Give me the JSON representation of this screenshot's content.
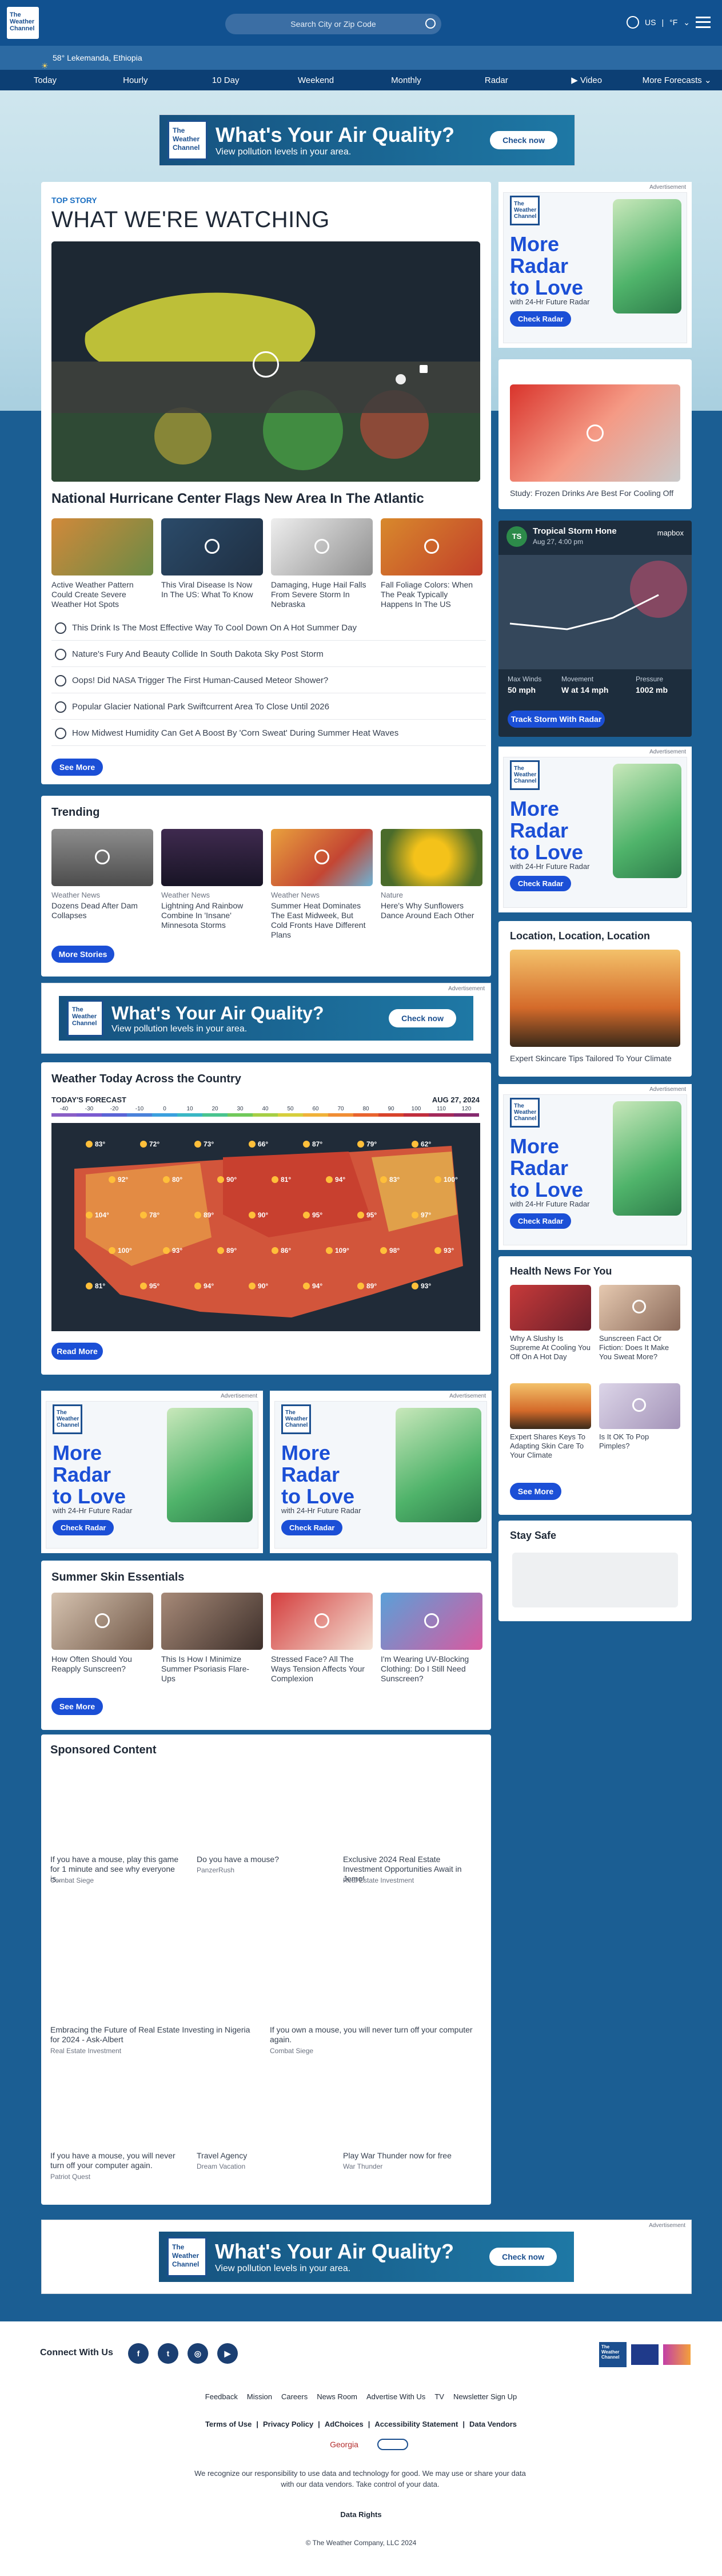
{
  "header": {
    "logo_text": "The Weather Channel",
    "search_placeholder": "Search City or Zip Code",
    "region": "US",
    "temp_unit": "°F"
  },
  "location": {
    "temp": "58°",
    "place": "Lekemanda, Ethiopia"
  },
  "nav": [
    "Today",
    "Hourly",
    "10 Day",
    "Weekend",
    "Monthly",
    "Radar",
    "Video",
    "More Forecasts"
  ],
  "air_ad": {
    "brand": "The Weather Channel",
    "headline": "What's Your Air Quality?",
    "sub": "View pollution levels in your area.",
    "cta": "Check now",
    "label": "Advertisement"
  },
  "radar_ad": {
    "brand": "The Weather Channel",
    "headline1": "More",
    "headline2": "Radar",
    "headline3": "to Love",
    "sub": "with 24-Hr Future Radar",
    "cta": "Check Radar",
    "label": "Advertisement"
  },
  "top_story": {
    "label": "TOP STORY",
    "title": "WHAT WE'RE WATCHING",
    "hero_caption": "National Hurricane Center Flags New Area In The Atlantic",
    "thumbs": [
      {
        "caption": "Active Weather Pattern Could Create Severe Weather Hot Spots"
      },
      {
        "caption": "This Viral Disease Is Now In The US: What To Know"
      },
      {
        "caption": "Damaging, Huge Hail Falls From Severe Storm In Nebraska"
      },
      {
        "caption": "Fall Foliage Colors: When The Peak Typically Happens In The US"
      }
    ],
    "list": [
      "This Drink Is The Most Effective Way To Cool Down On A Hot Summer Day",
      "Nature's Fury And Beauty Collide In South Dakota Sky Post Storm",
      "Oops! Did NASA Trigger The First Human-Caused Meteor Shower?",
      "Popular Glacier National Park Swiftcurrent Area To Close Until 2026",
      "How Midwest Humidity Can Get A Boost By 'Corn Sweat' During Summer Heat Waves"
    ],
    "more": "See More"
  },
  "trending": {
    "title": "Trending",
    "items": [
      {
        "tag": "Weather News",
        "caption": "Dozens Dead After Dam Collapses"
      },
      {
        "tag": "Weather News",
        "caption": "Lightning And Rainbow Combine In 'Insane' Minnesota Storms"
      },
      {
        "tag": "Weather News",
        "caption": "Summer Heat Dominates The East Midweek, But Cold Fronts Have Different Plans"
      },
      {
        "tag": "Nature",
        "caption": "Here's Why Sunflowers Dance Around Each Other"
      }
    ],
    "more": "More Stories"
  },
  "today_map": {
    "title": "Weather Today Across the Country",
    "forecast_label": "TODAY'S FORECAST",
    "date": "AUG 27, 2024",
    "scale": [
      "-40",
      "-30",
      "-20",
      "-10",
      "0",
      "10",
      "20",
      "30",
      "40",
      "50",
      "60",
      "70",
      "80",
      "90",
      "100",
      "110",
      "120"
    ],
    "temps": [
      "83°",
      "72°",
      "73°",
      "66°",
      "87°",
      "79°",
      "62°",
      "92°",
      "80°",
      "90°",
      "81°",
      "94°",
      "83°",
      "100°",
      "104°",
      "78°",
      "89°",
      "90°",
      "95°",
      "95°",
      "97°",
      "100°",
      "93°",
      "89°",
      "86°",
      "109°",
      "98°",
      "93°",
      "81°",
      "95°",
      "94°",
      "90°",
      "94°",
      "89°",
      "93°"
    ],
    "more": "Read More"
  },
  "skin": {
    "title": "Summer Skin Essentials",
    "items": [
      {
        "caption": "How Often Should You Reapply Sunscreen?"
      },
      {
        "caption": "This Is How I Minimize Summer Psoriasis Flare-Ups"
      },
      {
        "caption": "Stressed Face? All The Ways Tension Affects Your Complexion"
      },
      {
        "caption": "I'm Wearing UV-Blocking Clothing: Do I Still Need Sunscreen?"
      }
    ],
    "more": "See More"
  },
  "sponsored": {
    "title": "Sponsored Content",
    "items": [
      {
        "caption": "If you have a mouse, play this game for 1 minute and see why everyone is...",
        "source": "Combat Siege"
      },
      {
        "caption": "Do you have a mouse?",
        "source": "PanzerRush"
      },
      {
        "caption": "Exclusive 2024 Real Estate Investment Opportunities Await in Jemo!",
        "source": "Real Estate Investment"
      },
      {
        "caption": "Embracing the Future of Real Estate Investing in Nigeria for 2024 - Ask-Albert",
        "source": "Real Estate Investment"
      },
      {
        "caption": "If you own a mouse, you will never turn off your computer again.",
        "source": "Combat Siege"
      },
      {
        "caption": "If you have a mouse, you will never turn off your computer again.",
        "source": "Patriot Quest"
      },
      {
        "caption": "Travel Agency",
        "source": "Dream Vacation"
      },
      {
        "caption": "Play War Thunder now for free",
        "source": "War Thunder"
      }
    ]
  },
  "side": {
    "frozen_caption": "Study: Frozen Drinks Are Best For Cooling Off",
    "storm": {
      "name": "Tropical Storm Hone",
      "time": "Aug 27, 4:00 pm",
      "map_brand": "mapbox",
      "winds_label": "Max Winds",
      "winds": "50 mph",
      "move_label": "Movement",
      "move": "W at 14 mph",
      "pres_label": "Pressure",
      "pres": "1002 mb",
      "cta": "Track Storm With Radar",
      "badge": "TS"
    },
    "location": {
      "title": "Location, Location, Location",
      "caption": "Expert Skincare Tips Tailored To Your Climate"
    },
    "health": {
      "title": "Health News For You",
      "items": [
        {
          "caption": "Why A Slushy Is Supreme At Cooling You Off On A Hot Day"
        },
        {
          "caption": "Sunscreen Fact Or Fiction: Does It Make You Sweat More?"
        },
        {
          "caption": "Expert Shares Keys To Adapting Skin Care To Your Climate"
        },
        {
          "caption": "Is It OK To Pop Pimples?"
        }
      ],
      "more": "See More"
    },
    "safe": {
      "title": "Stay Safe"
    }
  },
  "footer": {
    "connect": "Connect With Us",
    "links1": [
      "Feedback",
      "Mission",
      "Careers",
      "News Room",
      "Advertise With Us",
      "TV",
      "Newsletter Sign Up"
    ],
    "links2": [
      "Terms of Use",
      "Privacy Policy",
      "AdChoices",
      "Accessibility Statement",
      "Data Vendors"
    ],
    "georgia": "Georgia",
    "responsibility": "We recognize our responsibility to use data and technology for good. We may use or share your data with our data vendors. Take control of your data.",
    "data_rights": "Data Rights",
    "copyright": "© The Weather Company, LLC 2024"
  },
  "colors": {
    "brand": "#115190",
    "link": "#1b4fd6",
    "page": "#1b5e93"
  }
}
